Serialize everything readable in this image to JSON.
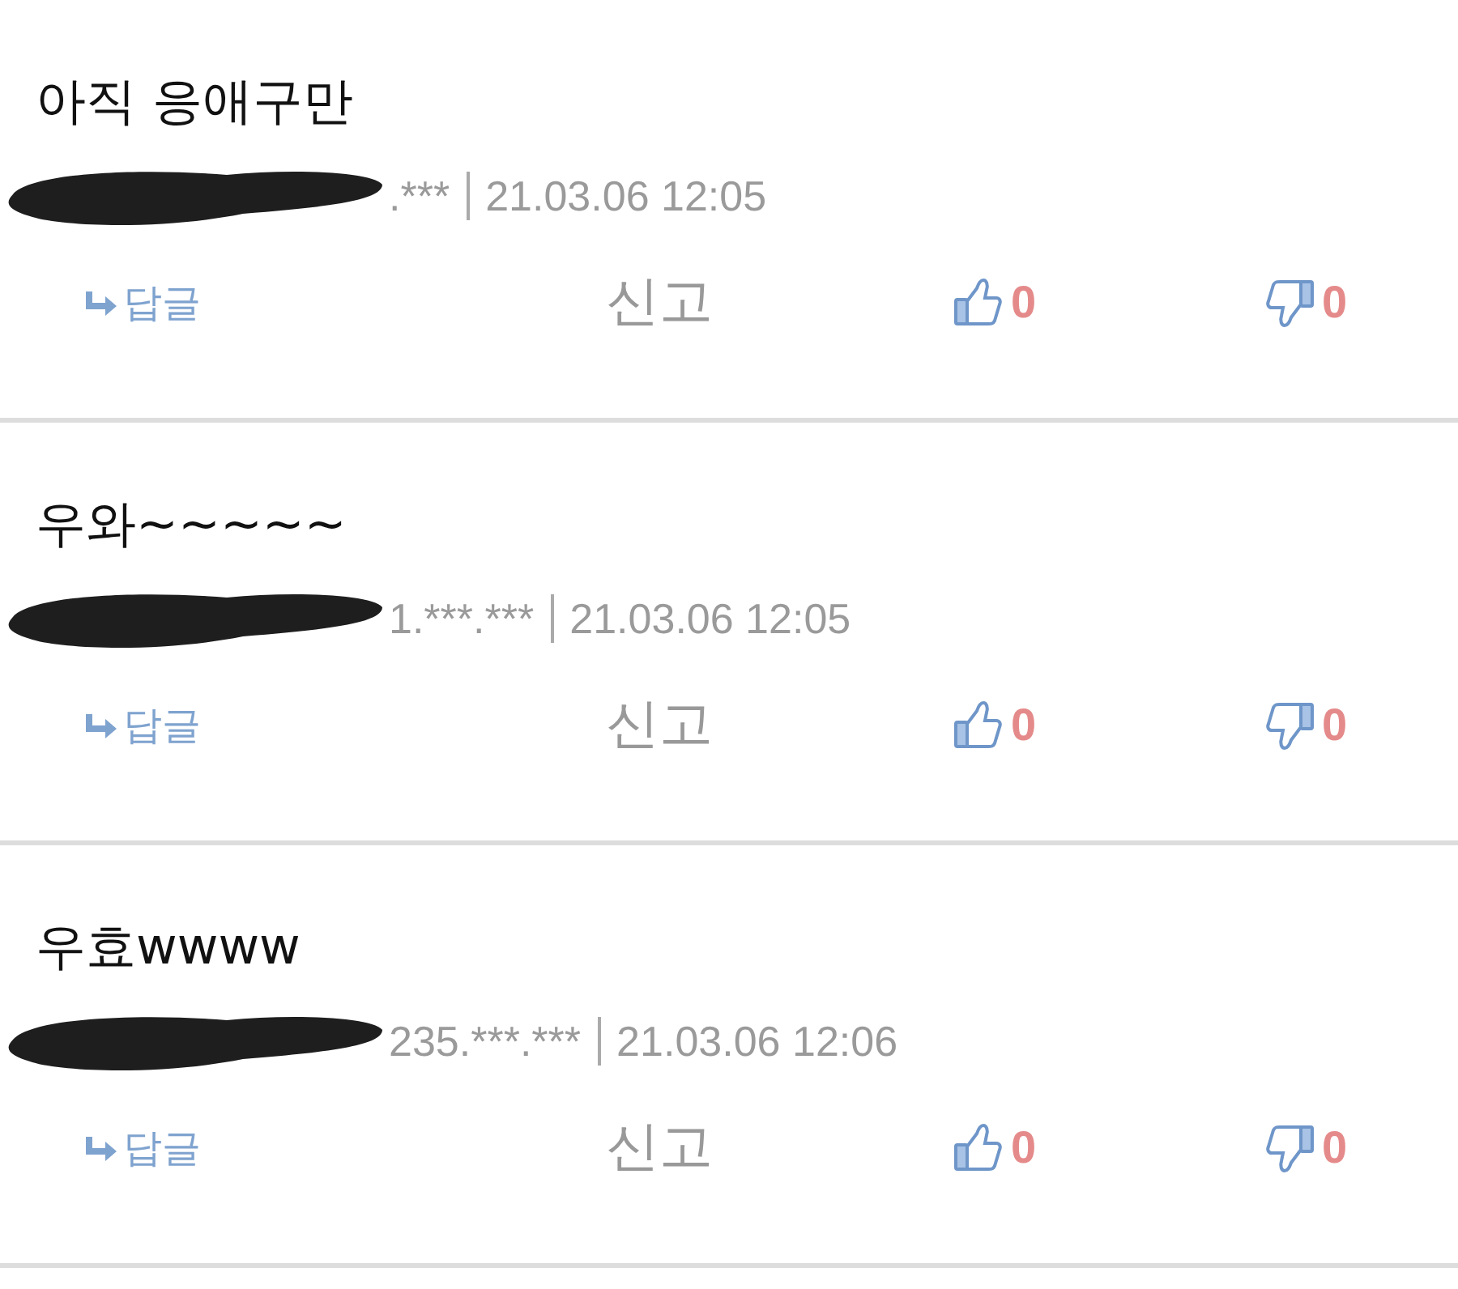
{
  "comments": [
    {
      "text": "아직 응애구만",
      "ip": ".***",
      "date": "21.03.06 12:05",
      "reply": "답글",
      "report": "신고",
      "likes": "0",
      "dislikes": "0"
    },
    {
      "text": "우와~~~~~",
      "ip": "1.***.***",
      "date": "21.03.06 12:05",
      "reply": "답글",
      "report": "신고",
      "likes": "0",
      "dislikes": "0"
    },
    {
      "text": "우효wwww",
      "ip": "235.***.***",
      "date": "21.03.06 12:06",
      "reply": "답글",
      "report": "신고",
      "likes": "0",
      "dislikes": "0"
    }
  ]
}
